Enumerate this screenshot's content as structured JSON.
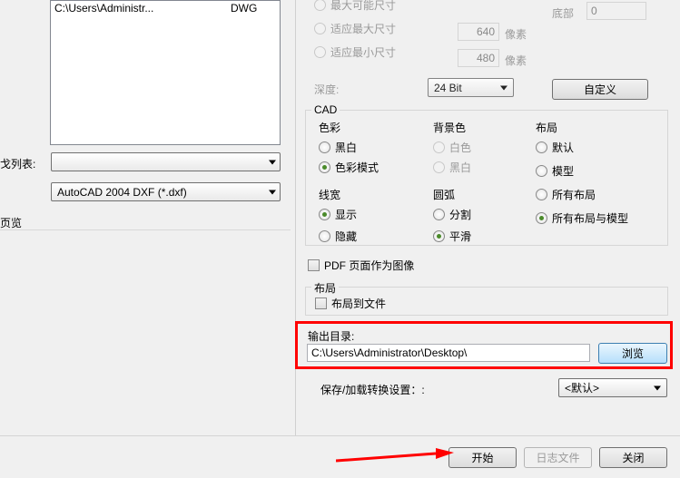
{
  "left": {
    "file_name": "C:\\Users\\Administr...",
    "file_type": "DWG",
    "label_list": "戈列表:",
    "label_preview": "页览",
    "format_value": "AutoCAD 2004 DXF (*.dxf)"
  },
  "size": {
    "opt_max_possible": "最大可能尺寸",
    "opt_fit_max": "适应最大尺寸",
    "opt_fit_min": "适应最小尺寸",
    "val_max": "640",
    "val_min": "480",
    "px": "像素",
    "depth_label": "深度:",
    "depth_value": "24 Bit",
    "bottom_label": "底部",
    "bottom_value": "0",
    "custom_btn": "自定义"
  },
  "cad_section_title": "CAD",
  "cad": {
    "color": {
      "legend": "色彩",
      "bw": "黑白",
      "colormode": "色彩模式"
    },
    "bg": {
      "legend": "背景色",
      "white": "白色",
      "black": "黑白"
    },
    "layout": {
      "legend": "布局",
      "default": "默认",
      "model": "模型",
      "all": "所有布局",
      "all_model": "所有布局与模型"
    },
    "lw": {
      "legend": "线宽",
      "show": "显示",
      "hide": "隐藏"
    },
    "arc": {
      "legend": "圆弧",
      "split": "分割",
      "smooth": "平滑"
    }
  },
  "pdf_check": "PDF 页面作为图像",
  "layout2": {
    "legend": "布局",
    "to_file": "布局到文件"
  },
  "output": {
    "label": "输出目录:",
    "path": "C:\\Users\\Administrator\\Desktop\\",
    "browse": "浏览"
  },
  "settings_label": "保存/加载转换设置：:",
  "settings_value": "<默认>",
  "footer": {
    "start": "开始",
    "log": "日志文件",
    "close": "关闭"
  }
}
